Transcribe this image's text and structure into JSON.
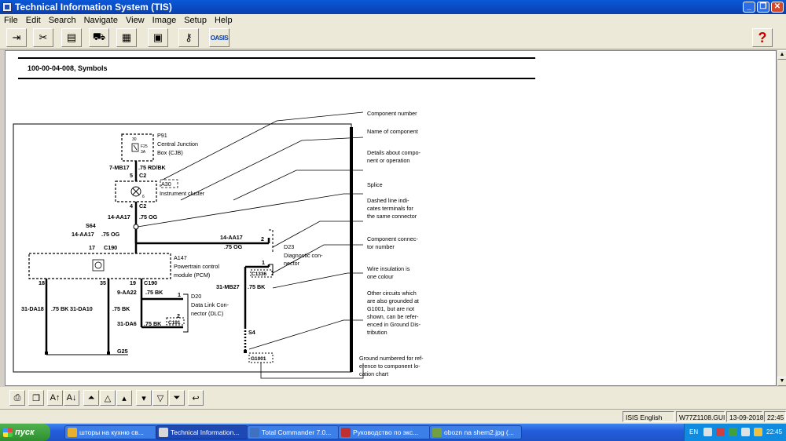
{
  "window": {
    "title": "Technical Information System (TIS)"
  },
  "menu": [
    "File",
    "Edit",
    "Search",
    "Navigate",
    "View",
    "Image",
    "Setup",
    "Help"
  ],
  "toolbar": {
    "buttons": [
      {
        "name": "exit-icon",
        "glyph": "⇥"
      },
      {
        "name": "tools-icon",
        "glyph": "✂"
      },
      {
        "name": "catalog-icon",
        "glyph": "▤"
      },
      {
        "name": "vehicle-icon",
        "glyph": "⛟"
      },
      {
        "name": "chip-icon",
        "glyph": "▦"
      },
      {
        "name": "calculator-icon",
        "glyph": "▣"
      },
      {
        "name": "key-icon",
        "glyph": "⚷"
      }
    ],
    "oasis_label": "OASIS",
    "help_glyph": "?"
  },
  "document": {
    "title": "100-00-04-008, Symbols",
    "diagram": {
      "labels": {
        "p91": "P91",
        "cjb1": "Central Junction",
        "cjb2": "Box (CJB)",
        "fuse_top": "30",
        "fuse_id": "F25",
        "fuse_amp": "3A",
        "w_7mb17": "7-MB17",
        "w_75rdbk": ".75 RD/BK",
        "pin5": "5",
        "c2a": "C2",
        "a30": "A30",
        "inst_cluster": "Instrument cluster",
        "pin6": "6",
        "pin4": "4",
        "c2b": "C2",
        "w_14aa17a": "14-AA17",
        "w_75og_a": ".75 OG",
        "s64": "S64",
        "w_14aa17b": "14-AA17",
        "w_75og_b": ".75 OG",
        "pin17": "17",
        "c190a": "C190",
        "w_14aa17c": "14-AA17",
        "pin2a": "2",
        "w_75og_c": ".75 OG",
        "d23": "D23",
        "d23_1": "Diagnostic con-",
        "d23_2": "nector",
        "pin1a": "1",
        "c1336": "C1336",
        "a147": "A147",
        "pcm1": "Powertrain control",
        "pcm2": "module (PCM)",
        "pin18": "18",
        "pin35": "35",
        "pin19": "19",
        "c190b": "C190",
        "w_31mb27": "31-MB27",
        "w_75bk_d": ".75 BK",
        "w_9aa22": "9-AA22",
        "w_75bk_e": ".75 BK",
        "pin1b": "1",
        "d20": "D20",
        "dlc1": "Data Link Con-",
        "dlc2": "nector (DLC)",
        "w_31da18": "31-DA18",
        "w_75bk_a": ".75 BK",
        "w_31da10": "31-DA10",
        "w_75bk_b": ".75 BK",
        "w_31da6": "31-DA6",
        "w_75bk_c": ".75 BK",
        "pin2b": "2",
        "c191": "C191",
        "s4": "S4",
        "g25": "G25",
        "g1001": "G1001"
      },
      "callouts": [
        [
          "Component number"
        ],
        [
          "Name of component"
        ],
        [
          "Details about compo-",
          "nent or operation"
        ],
        [
          "Splice"
        ],
        [
          "Dashed line indi-",
          "cates terminals for",
          "the same connector"
        ],
        [
          "Component connec-",
          "tor number"
        ],
        [
          "Wire insulation is",
          "one colour"
        ],
        [
          "Other circuits which",
          "are also grounded at",
          "G1001, but are not",
          "shown, can be refer-",
          "enced in Ground Dis-",
          "tribution"
        ],
        [
          "Ground numbered for ref-",
          "erence to component lo-",
          "cation chart"
        ]
      ]
    }
  },
  "navbar": {
    "buttons": [
      {
        "name": "print-icon",
        "glyph": "⎙"
      },
      {
        "name": "copy-icon",
        "glyph": "❐"
      },
      {
        "name": "font-larger-icon",
        "glyph": "A↑"
      },
      {
        "name": "font-smaller-icon",
        "glyph": "A↓"
      },
      {
        "name": "first-page-icon",
        "glyph": "⏶"
      },
      {
        "name": "prev-page-icon",
        "glyph": "△"
      },
      {
        "name": "prev-section-icon",
        "glyph": "▴"
      },
      {
        "name": "next-section-icon",
        "glyph": "▾"
      },
      {
        "name": "next-page-icon",
        "glyph": "▽"
      },
      {
        "name": "last-page-icon",
        "glyph": "⏷"
      },
      {
        "name": "back-icon",
        "glyph": "↩"
      }
    ]
  },
  "status": {
    "language": "ISIS English",
    "file": "W77Z1108.GUI",
    "date": "13-09-2018",
    "time": "22:45"
  },
  "taskbar": {
    "start_label": "пуск",
    "tasks": [
      {
        "label": "шторы на кухню св...",
        "color": "#e8b030",
        "active": false
      },
      {
        "label": "Technical Information...",
        "color": "#d8d8d8",
        "active": true
      },
      {
        "label": "Total Commander 7.0...",
        "color": "#4070c0",
        "active": false
      },
      {
        "label": "Руководство по экс...",
        "color": "#c03030",
        "active": false
      },
      {
        "label": "obozn na shem2.jpg (...",
        "color": "#70a040",
        "active": false
      }
    ],
    "tray_lang": "EN",
    "clock": "22:45"
  }
}
